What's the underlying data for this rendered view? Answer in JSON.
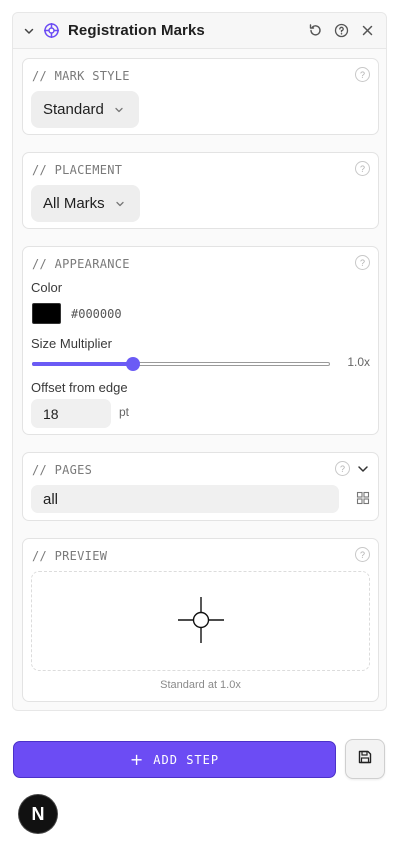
{
  "panel": {
    "title": "Registration Marks"
  },
  "mark_style": {
    "label": "// MARK STYLE",
    "help": "?",
    "value": "Standard"
  },
  "placement": {
    "label": "// PLACEMENT",
    "help": "?",
    "value": "All Marks"
  },
  "appearance": {
    "label": "// APPEARANCE",
    "help": "?",
    "color_label": "Color",
    "color_value": "#000000",
    "size_label": "Size Multiplier",
    "size_value_text": "1.0x",
    "size_fraction": 0.34,
    "offset_label": "Offset from edge",
    "offset_value": "18",
    "offset_unit": "pt"
  },
  "pages": {
    "label": "// PAGES",
    "help": "?",
    "value": "all"
  },
  "preview": {
    "label": "// PREVIEW",
    "help": "?",
    "caption": "Standard at 1.0x"
  },
  "actions": {
    "add_step_label": "ADD STEP",
    "add_step_icon": "+"
  },
  "app_logo": {
    "letter": "N"
  },
  "colors": {
    "accent": "#6c4cf4",
    "slider": "#6b5bf5"
  }
}
